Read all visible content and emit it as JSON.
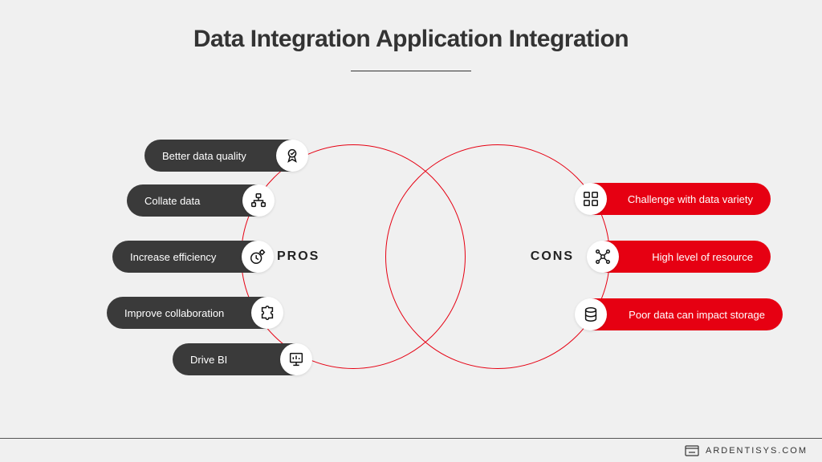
{
  "title": "Data Integration Application Integration",
  "left_label": "PROS",
  "right_label": "CONS",
  "pros": [
    {
      "label": "Better data quality",
      "icon": "award-icon"
    },
    {
      "label": "Collate data",
      "icon": "org-chart-icon"
    },
    {
      "label": "Increase efficiency",
      "icon": "clock-gear-icon"
    },
    {
      "label": "Improve collaboration",
      "icon": "puzzle-icon"
    },
    {
      "label": "Drive BI",
      "icon": "presentation-icon"
    }
  ],
  "cons": [
    {
      "label": "Challenge with data variety",
      "icon": "data-variety-icon"
    },
    {
      "label": "High level of resource",
      "icon": "network-icon"
    },
    {
      "label": "Poor data can impact storage",
      "icon": "storage-icon"
    }
  ],
  "footer": "ARDENTISYS.COM"
}
